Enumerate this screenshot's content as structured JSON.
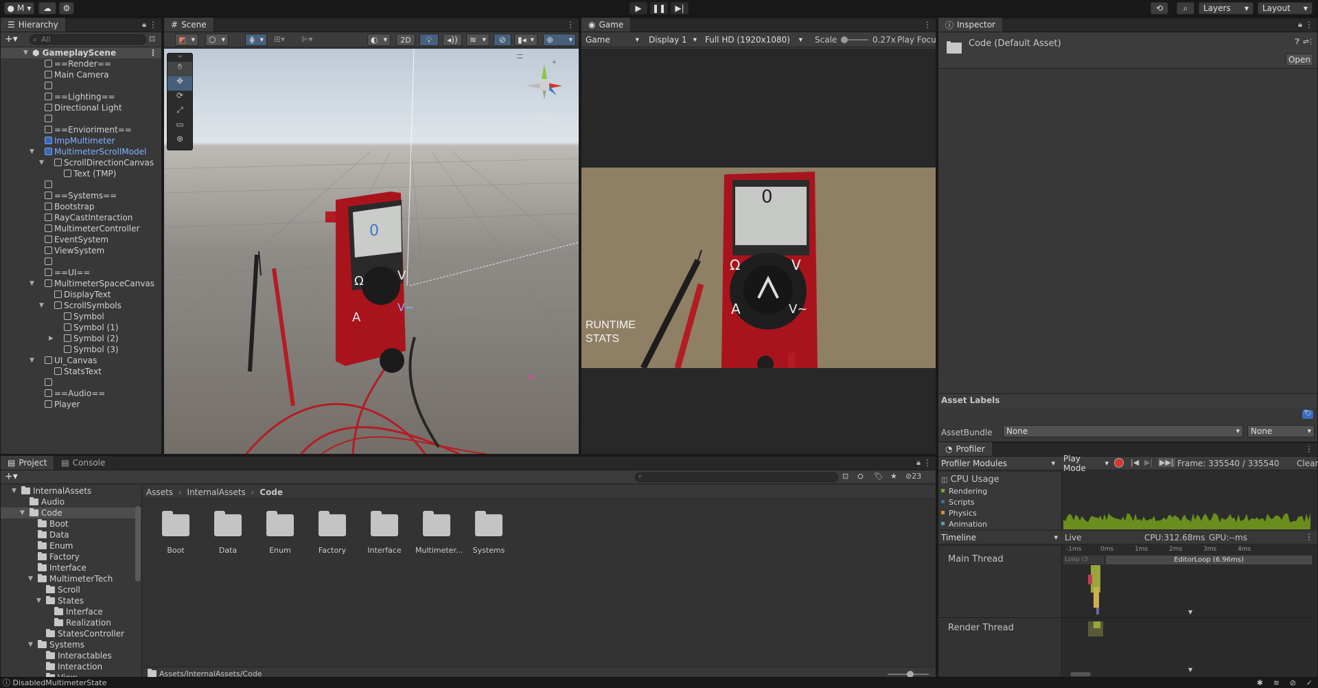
{
  "toolbar": {
    "account_label": "M",
    "layers_label": "Layers",
    "layout_label": "Layout"
  },
  "hierarchy": {
    "tab_label": "Hierarchy",
    "search_placeholder": "All",
    "scene_name": "GameplayScene",
    "items": [
      {
        "label": "==Render==",
        "depth": 2,
        "color": "normal",
        "arrow": ""
      },
      {
        "label": "Main Camera",
        "depth": 2,
        "color": "normal",
        "arrow": ""
      },
      {
        "label": "",
        "depth": 2,
        "color": "normal",
        "arrow": ""
      },
      {
        "label": "==Lighting==",
        "depth": 2,
        "color": "normal",
        "arrow": ""
      },
      {
        "label": "Directional Light",
        "depth": 2,
        "color": "normal",
        "arrow": ""
      },
      {
        "label": "",
        "depth": 2,
        "color": "normal",
        "arrow": ""
      },
      {
        "label": "==Envioriment==",
        "depth": 2,
        "color": "normal",
        "arrow": ""
      },
      {
        "label": "ImpMultimeter",
        "depth": 2,
        "color": "blue",
        "arrow": ""
      },
      {
        "label": "MultimeterScrollModel",
        "depth": 2,
        "color": "blue",
        "arrow": "open"
      },
      {
        "label": "ScrollDirectionCanvas",
        "depth": 3,
        "color": "normal",
        "arrow": "open"
      },
      {
        "label": "Text (TMP)",
        "depth": 4,
        "color": "normal",
        "arrow": ""
      },
      {
        "label": "",
        "depth": 2,
        "color": "normal",
        "arrow": ""
      },
      {
        "label": "==Systems==",
        "depth": 2,
        "color": "normal",
        "arrow": ""
      },
      {
        "label": "Bootstrap",
        "depth": 2,
        "color": "normal",
        "arrow": ""
      },
      {
        "label": "RayCastInteraction",
        "depth": 2,
        "color": "normal",
        "arrow": ""
      },
      {
        "label": "MultimeterController",
        "depth": 2,
        "color": "normal",
        "arrow": ""
      },
      {
        "label": "EventSystem",
        "depth": 2,
        "color": "normal",
        "arrow": ""
      },
      {
        "label": "ViewSystem",
        "depth": 2,
        "color": "normal",
        "arrow": ""
      },
      {
        "label": "",
        "depth": 2,
        "color": "normal",
        "arrow": ""
      },
      {
        "label": "==UI==",
        "depth": 2,
        "color": "normal",
        "arrow": ""
      },
      {
        "label": "MultimeterSpaceCanvas",
        "depth": 2,
        "color": "normal",
        "arrow": "open"
      },
      {
        "label": "DisplayText",
        "depth": 3,
        "color": "normal",
        "arrow": ""
      },
      {
        "label": "ScrollSymbols",
        "depth": 3,
        "color": "normal",
        "arrow": "open"
      },
      {
        "label": "Symbol",
        "depth": 4,
        "color": "normal",
        "arrow": ""
      },
      {
        "label": "Symbol (1)",
        "depth": 4,
        "color": "normal",
        "arrow": ""
      },
      {
        "label": "Symbol (2)",
        "depth": 4,
        "color": "normal",
        "arrow": "closed"
      },
      {
        "label": "Symbol (3)",
        "depth": 4,
        "color": "normal",
        "arrow": ""
      },
      {
        "label": "UI_Canvas",
        "depth": 2,
        "color": "normal",
        "arrow": "open"
      },
      {
        "label": "StatsText",
        "depth": 3,
        "color": "normal",
        "arrow": ""
      },
      {
        "label": "",
        "depth": 2,
        "color": "normal",
        "arrow": ""
      },
      {
        "label": "==Audio==",
        "depth": 2,
        "color": "normal",
        "arrow": ""
      },
      {
        "label": "Player",
        "depth": 2,
        "color": "normal",
        "arrow": ""
      }
    ]
  },
  "scene": {
    "tab_label": "Scene",
    "mode_2d": "2D",
    "persp_label": "< Persp",
    "display_digit": "0",
    "sym_omega": "Ω",
    "sym_v": "V",
    "sym_a": "A",
    "sym_vac": "V~"
  },
  "game": {
    "tab_label": "Game",
    "view_dropdown": "Game",
    "display_dropdown": "Display 1",
    "resolution_dropdown": "Full HD (1920x1080)",
    "scale_label": "Scale",
    "scale_value": "0.27x",
    "play_focus": "Play Focu",
    "display_digit": "0",
    "sym_omega": "Ω",
    "sym_v": "V",
    "sym_a": "A",
    "sym_vac": "V~",
    "stats_text": "RUNTIME STATS"
  },
  "inspector": {
    "tab_label": "Inspector",
    "asset_title": "Code (Default Asset)",
    "open_button": "Open",
    "asset_labels_title": "Asset Labels",
    "assetbundle_label": "AssetBundle",
    "assetbundle_value": "None",
    "variant_value": "None"
  },
  "profiler": {
    "tab_label": "Profiler",
    "modules_dropdown": "Profiler Modules",
    "mode_dropdown": "Play Mode",
    "frame_label": "Frame: 335540 / 335540",
    "clear_button": "Clear",
    "cpu_usage_title": "CPU Usage",
    "categories": [
      {
        "label": "Rendering",
        "color": "#7aa53a"
      },
      {
        "label": "Scripts",
        "color": "#3b6ea5"
      },
      {
        "label": "Physics",
        "color": "#d39235"
      },
      {
        "label": "Animation",
        "color": "#4ea3a4"
      }
    ],
    "timeline_dropdown": "Timeline",
    "live_label": "Live",
    "cpu_ms": "CPU:312.68ms",
    "gpu_ms": "GPU:--ms",
    "ticks": [
      "-1ms",
      "0ms",
      "1ms",
      "2ms",
      "3ms",
      "4ms"
    ],
    "main_thread": "Main Thread",
    "render_thread": "Render Thread",
    "editor_loop": "EditorLoop (6.96ms)",
    "loop_label": "Loop (3"
  },
  "project": {
    "tab_project": "Project",
    "tab_console": "Console",
    "hidden_count": "23",
    "tree": [
      {
        "label": "InternalAssets",
        "depth": 1,
        "arrow": "open"
      },
      {
        "label": "Audio",
        "depth": 2,
        "arrow": ""
      },
      {
        "label": "Code",
        "depth": 2,
        "arrow": "open",
        "selected": true
      },
      {
        "label": "Boot",
        "depth": 3,
        "arrow": ""
      },
      {
        "label": "Data",
        "depth": 3,
        "arrow": ""
      },
      {
        "label": "Enum",
        "depth": 3,
        "arrow": ""
      },
      {
        "label": "Factory",
        "depth": 3,
        "arrow": ""
      },
      {
        "label": "Interface",
        "depth": 3,
        "arrow": ""
      },
      {
        "label": "MultimeterTech",
        "depth": 3,
        "arrow": "open"
      },
      {
        "label": "Scroll",
        "depth": 4,
        "arrow": ""
      },
      {
        "label": "States",
        "depth": 4,
        "arrow": "open"
      },
      {
        "label": "Interface",
        "depth": 5,
        "arrow": ""
      },
      {
        "label": "Realization",
        "depth": 5,
        "arrow": ""
      },
      {
        "label": "StatesController",
        "depth": 4,
        "arrow": ""
      },
      {
        "label": "Systems",
        "depth": 3,
        "arrow": "open"
      },
      {
        "label": "Interactables",
        "depth": 4,
        "arrow": ""
      },
      {
        "label": "Interaction",
        "depth": 4,
        "arrow": ""
      },
      {
        "label": "View",
        "depth": 4,
        "arrow": ""
      }
    ],
    "breadcrumb": [
      "Assets",
      "InternalAssets",
      "Code"
    ],
    "folders": [
      "Boot",
      "Data",
      "Enum",
      "Factory",
      "Interface",
      "Multimeter...",
      "Systems"
    ],
    "path_label": "Assets/InternalAssets/Code"
  },
  "status": {
    "message": "DisabledMultimeterState"
  }
}
